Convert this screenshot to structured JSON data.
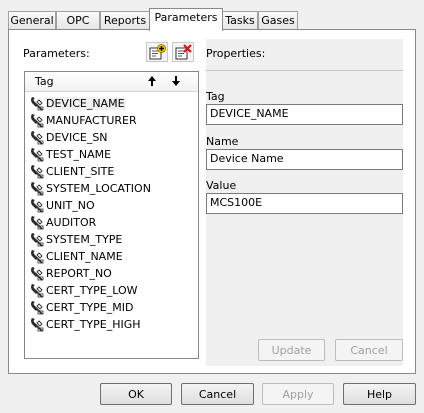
{
  "tabs": [
    {
      "label": "General"
    },
    {
      "label": "OPC"
    },
    {
      "label": "Reports"
    },
    {
      "label": "Parameters"
    },
    {
      "label": "Tasks"
    },
    {
      "label": "Gases"
    }
  ],
  "active_tab": "Parameters",
  "parameters": {
    "label": "Parameters:",
    "add_icon": "add-parameter-icon",
    "remove_icon": "remove-parameter-icon",
    "column_header": "Tag",
    "sort_up_icon": "arrow-up-icon",
    "sort_down_icon": "arrow-down-icon",
    "items": [
      {
        "label": "DEVICE_NAME"
      },
      {
        "label": "MANUFACTURER"
      },
      {
        "label": "DEVICE_SN"
      },
      {
        "label": "TEST_NAME"
      },
      {
        "label": "CLIENT_SITE"
      },
      {
        "label": "SYSTEM_LOCATION"
      },
      {
        "label": "UNIT_NO"
      },
      {
        "label": "AUDITOR"
      },
      {
        "label": "SYSTEM_TYPE"
      },
      {
        "label": "CLIENT_NAME"
      },
      {
        "label": "REPORT_NO"
      },
      {
        "label": "CERT_TYPE_LOW"
      },
      {
        "label": "CERT_TYPE_MID"
      },
      {
        "label": "CERT_TYPE_HIGH"
      }
    ],
    "selected": "DEVICE_NAME"
  },
  "properties": {
    "label": "Properties:",
    "tag_label": "Tag",
    "tag_value": "DEVICE_NAME",
    "name_label": "Name",
    "name_value": "Device Name",
    "value_label": "Value",
    "value_value": "MCS100E",
    "update_label": "Update",
    "cancel_label": "Cancel"
  },
  "dialog_buttons": {
    "ok": "OK",
    "cancel": "Cancel",
    "apply": "Apply",
    "help": "Help"
  }
}
